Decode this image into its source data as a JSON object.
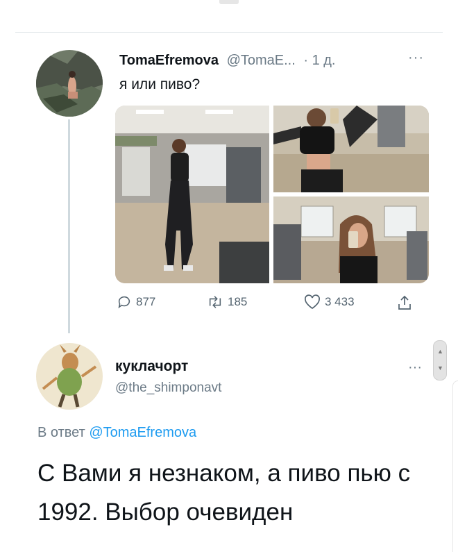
{
  "tweet": {
    "display_name": "TomaEfremova",
    "handle": "@TomaE...",
    "time": "· 1 д.",
    "more_icon": "more-horizontal-icon",
    "text": "я или пиво?",
    "media": [
      {
        "name": "gym-photo-full"
      },
      {
        "name": "gym-photo-mirror-top"
      },
      {
        "name": "gym-photo-mirror-bottom"
      }
    ],
    "stats": {
      "replies": "877",
      "retweets": "185",
      "likes": "3 433"
    }
  },
  "reply": {
    "display_name": "куклачорт",
    "handle": "@the_shimponavt",
    "reply_label": "В ответ",
    "reply_mention": "@TomaEfremova",
    "text": "С Вами я незнаком, а пиво пью с 1992. Выбор очевиден"
  },
  "colors": {
    "accent": "#1d9bf0",
    "muted": "#6b7a86",
    "text": "#0f1419"
  }
}
